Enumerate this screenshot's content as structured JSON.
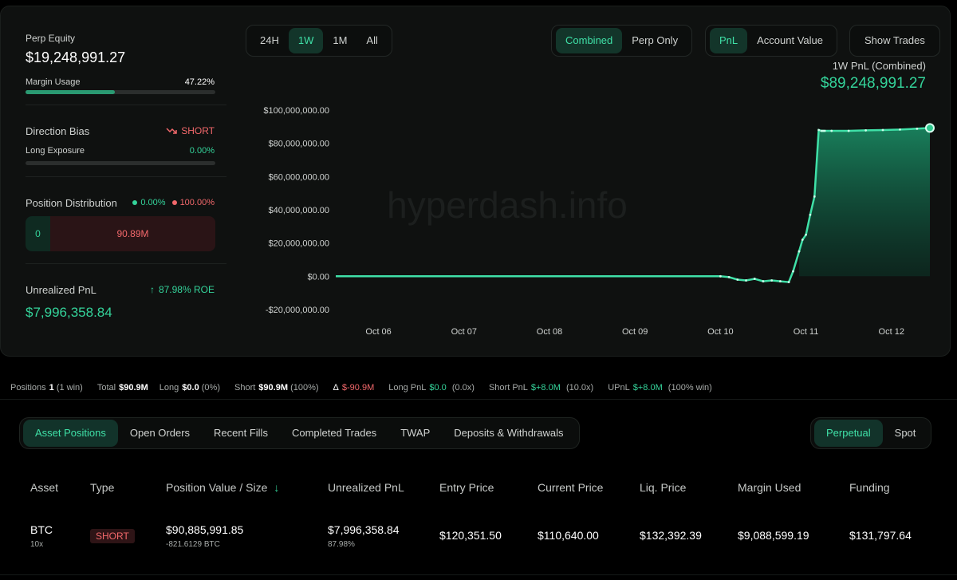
{
  "summary": {
    "perp_equity_label": "Perp Equity",
    "perp_equity_value": "$19,248,991.27",
    "margin_usage_label": "Margin Usage",
    "margin_usage_value": "47.22%",
    "margin_usage_fraction": 0.4722,
    "direction_bias_label": "Direction Bias",
    "direction_bias_value": "SHORT",
    "long_exposure_label": "Long Exposure",
    "long_exposure_value": "0.00%",
    "long_exposure_fraction": 0.0,
    "position_distribution_label": "Position Distribution",
    "dist_long_pct": "0.00%",
    "dist_short_pct": "100.00%",
    "dist_long_value": "0",
    "dist_short_value": "90.89M",
    "unrealized_pnl_label": "Unrealized PnL",
    "roe_label": "87.98% ROE",
    "unrealized_pnl_value": "$7,996,358.84"
  },
  "controls": {
    "timeframes": [
      "24H",
      "1W",
      "1M",
      "All"
    ],
    "active_timeframe": "1W",
    "modes": [
      "Combined",
      "Perp Only"
    ],
    "active_mode": "Combined",
    "metrics": [
      "PnL",
      "Account Value"
    ],
    "active_metric": "PnL",
    "show_trades": "Show Trades"
  },
  "chart_header": {
    "label": "1W PnL (Combined)",
    "value": "$89,248,991.27"
  },
  "watermark": "hyperdash.info",
  "chart_data": {
    "type": "area",
    "title": "1W PnL (Combined)",
    "yticks": [
      "$100,000,000.00",
      "$80,000,000.00",
      "$60,000,000.00",
      "$40,000,000.00",
      "$20,000,000.00",
      "$0.00",
      "-$20,000,000.00"
    ],
    "ylim": [
      -20000000,
      100000000
    ],
    "xticks": [
      "Oct 06",
      "Oct 07",
      "Oct 08",
      "Oct 09",
      "Oct 10",
      "Oct 11",
      "Oct 12"
    ],
    "xlim": [
      5.5,
      12.45
    ],
    "x": [
      5.5,
      6.0,
      7.0,
      8.0,
      9.0,
      10.0,
      10.1,
      10.2,
      10.3,
      10.4,
      10.5,
      10.6,
      10.7,
      10.8,
      10.85,
      10.92,
      10.96,
      11.0,
      11.05,
      11.1,
      11.15,
      11.18,
      11.2,
      11.22,
      11.3,
      11.5,
      11.7,
      11.9,
      12.1,
      12.3,
      12.45
    ],
    "values": [
      0,
      0,
      0,
      0,
      0,
      0,
      -500000,
      -2000000,
      -2500000,
      -1500000,
      -3000000,
      -2500000,
      -3000000,
      -3500000,
      3000000,
      15000000,
      22000000,
      25000000,
      37000000,
      48000000,
      88000000,
      87500000,
      87500000,
      87500000,
      87500000,
      87500000,
      87800000,
      88000000,
      88300000,
      88800000,
      89248991.27
    ],
    "grid": false
  },
  "stats": {
    "positions_label": "Positions",
    "positions_value": "1",
    "positions_extra": "(1 win)",
    "total_label": "Total",
    "total_value": "$90.9M",
    "long_label": "Long",
    "long_value": "$0.0",
    "long_extra": "(0%)",
    "short_label": "Short",
    "short_value": "$90.9M",
    "short_extra": "(100%)",
    "delta_label": "Δ",
    "delta_value": "$-90.9M",
    "long_pnl_label": "Long PnL",
    "long_pnl_value": "$0.0",
    "long_pnl_extra": "(0.0x)",
    "short_pnl_label": "Short PnL",
    "short_pnl_value": "$+8.0M",
    "short_pnl_extra": "(10.0x)",
    "upnl_label": "UPnL",
    "upnl_value": "$+8.0M",
    "upnl_extra": "(100% win)"
  },
  "tabs": [
    "Asset Positions",
    "Open Orders",
    "Recent Fills",
    "Completed Trades",
    "TWAP",
    "Deposits & Withdrawals"
  ],
  "active_tab": "Asset Positions",
  "market_tabs": [
    "Perpetual",
    "Spot"
  ],
  "active_market_tab": "Perpetual",
  "table": {
    "headers": [
      "Asset",
      "Type",
      "Position Value / Size",
      "Unrealized PnL",
      "Entry Price",
      "Current Price",
      "Liq. Price",
      "Margin Used",
      "Funding"
    ],
    "sort_indicator": "↓",
    "rows": [
      {
        "asset": "BTC",
        "leverage": "10x",
        "type": "SHORT",
        "position_value": "$90,885,991.85",
        "size": "-821.6129 BTC",
        "unrealized_pnl": "$7,996,358.84",
        "unrealized_pct": "87.98%",
        "entry_price": "$120,351.50",
        "current_price": "$110,640.00",
        "liq_price": "$132,392.39",
        "margin_used": "$9,088,599.19",
        "funding": "$131,797.64"
      }
    ]
  },
  "colors": {
    "accent_green": "#34d39a",
    "short_red": "#f2686b",
    "background": "#000000",
    "panel": "#0f1110"
  }
}
